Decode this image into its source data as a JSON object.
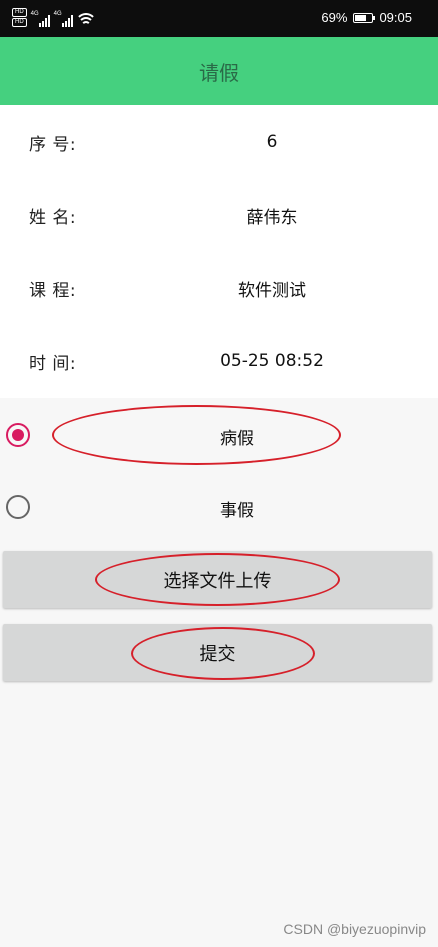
{
  "status_bar": {
    "hd_top": "HD",
    "hd_bottom": "HD",
    "net_1": "4G",
    "net_2": "4G",
    "battery": "69%",
    "time": "09:05",
    "icons": [
      "signal-icon",
      "wifi-icon",
      "battery-icon"
    ]
  },
  "app_bar": {
    "title": "请假"
  },
  "info": {
    "rows": [
      {
        "label": "序 号:",
        "value": "6"
      },
      {
        "label": "姓 名:",
        "value": "薛伟东"
      },
      {
        "label": "课 程:",
        "value": "软件测试"
      },
      {
        "label": "时 间:",
        "value": "05-25 08:52"
      }
    ]
  },
  "leave_type": {
    "options": [
      {
        "label": "病假",
        "checked": true
      },
      {
        "label": "事假",
        "checked": false
      }
    ]
  },
  "actions": {
    "upload_label": "选择文件上传",
    "submit_label": "提交"
  },
  "watermark": "CSDN @biyezuopinvip",
  "colors": {
    "app_bar": "#45d07f",
    "accent": "#d81b60",
    "annotation": "#d6202a"
  }
}
